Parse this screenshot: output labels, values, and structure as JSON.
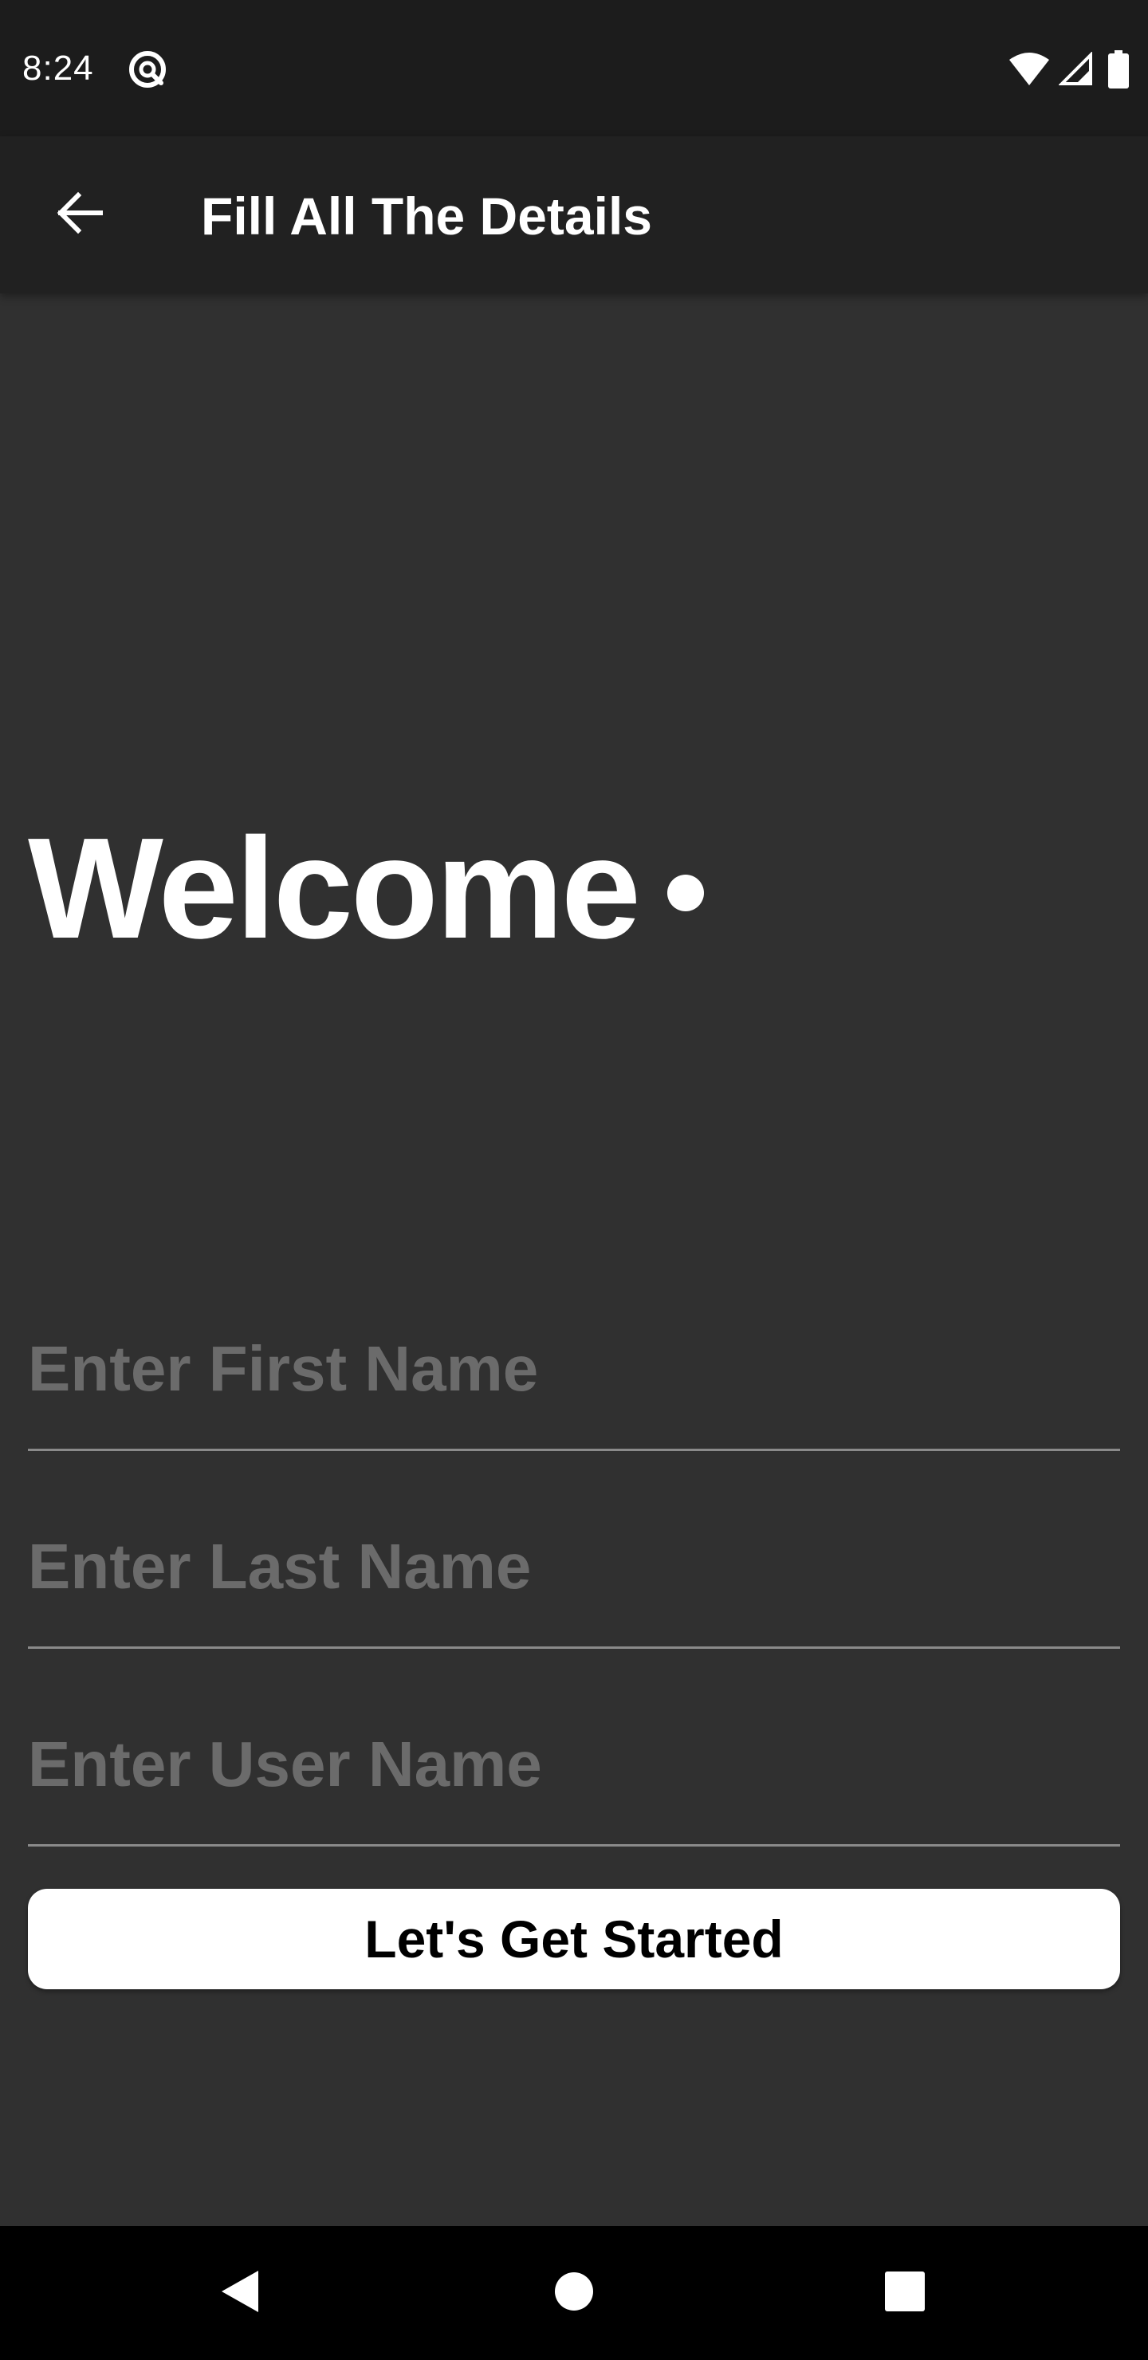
{
  "status_bar": {
    "time": "8:24",
    "app_icon": "at-sign-icon",
    "icons": [
      "wifi-icon",
      "cellular-signal-icon",
      "battery-icon"
    ]
  },
  "app_bar": {
    "title": "Fill All The Details",
    "back_icon": "arrow-left-icon"
  },
  "main": {
    "welcome": "Welcome",
    "fields": {
      "first_name": {
        "placeholder": "Enter First Name",
        "value": ""
      },
      "last_name": {
        "placeholder": "Enter Last Name",
        "value": ""
      },
      "user_name": {
        "placeholder": "Enter User Name",
        "value": ""
      }
    },
    "start_button": "Let's Get Started"
  },
  "nav_bar": {
    "icons": [
      "nav-back-icon",
      "nav-home-icon",
      "nav-recents-icon"
    ]
  },
  "colors": {
    "background": "#303030",
    "status_bar": "#1c1c1c",
    "app_bar": "#212121",
    "text": "#ffffff",
    "placeholder": "#6b6b6b",
    "underline": "#8a8a8a",
    "button_bg": "#ffffff",
    "button_text": "#000000",
    "nav_bar": "#000000"
  }
}
